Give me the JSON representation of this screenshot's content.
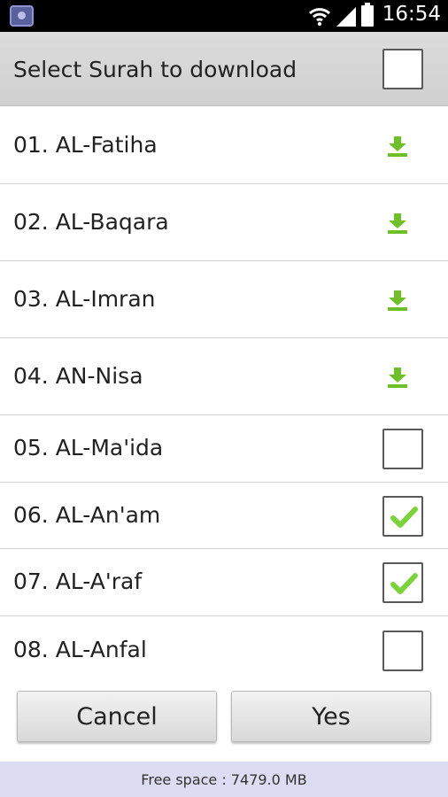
{
  "status_bar": {
    "time": "16:54",
    "icons": [
      "app-icon",
      "wifi-icon",
      "signal-icon",
      "battery-icon"
    ]
  },
  "header": {
    "title": "Select Surah to download",
    "select_all_checked": false
  },
  "surahs": [
    {
      "label": "01. AL-Fatiha",
      "state": "download"
    },
    {
      "label": "02. AL-Baqara",
      "state": "download"
    },
    {
      "label": "03. AL-Imran",
      "state": "download"
    },
    {
      "label": "04. AN-Nisa",
      "state": "download"
    },
    {
      "label": "05. AL-Ma'ida",
      "state": "unchecked"
    },
    {
      "label": "06. AL-An'am",
      "state": "checked"
    },
    {
      "label": "07. AL-A'raf",
      "state": "checked"
    },
    {
      "label": "08. AL-Anfal",
      "state": "unchecked"
    }
  ],
  "buttons": {
    "cancel_label": "Cancel",
    "yes_label": "Yes"
  },
  "footer": {
    "free_space": "Free space : 7479.0 MB"
  },
  "colors": {
    "download_green": "#6fbf2a",
    "check_green": "#7cd23a",
    "footer_bg": "#dcdcf2"
  }
}
